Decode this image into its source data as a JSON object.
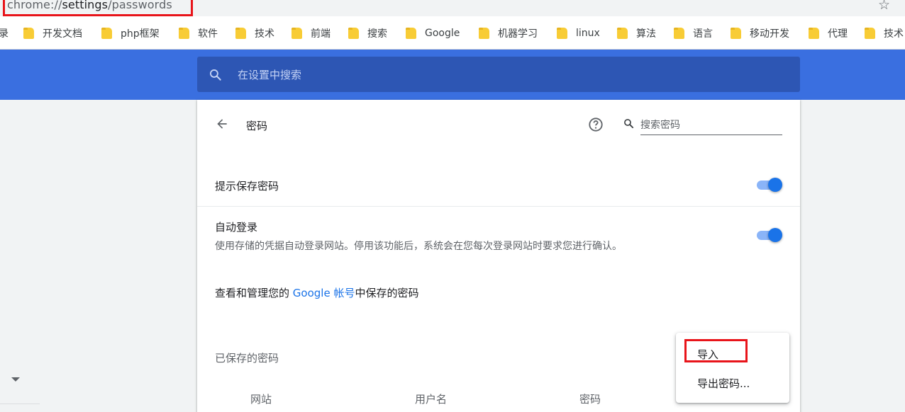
{
  "browser": {
    "url_prefix": "chrome://",
    "url_host": "settings",
    "url_sep": "/",
    "url_path": "passwords",
    "bookmark_icon": "star-icon"
  },
  "bookmarks": [
    "录",
    "开发文档",
    "php框架",
    "软件",
    "技术",
    "前端",
    "搜索",
    "Google",
    "机器学习",
    "linux",
    "算法",
    "语言",
    "移动开发",
    "代理",
    "技术"
  ],
  "settings": {
    "search_placeholder": "在设置中搜索"
  },
  "passwords": {
    "title": "密码",
    "search_placeholder": "搜索密码",
    "offer_to_save": "提示保存密码",
    "offer_to_save_enabled": true,
    "auto_signin": "自动登录",
    "auto_signin_desc": "使用存储的凭据自动登录网站。停用该功能后，系统会在您每次登录网站时要求您进行确认。",
    "auto_signin_enabled": true,
    "manage_prefix": "查看和管理您的 ",
    "manage_link": "Google 帐号",
    "manage_suffix": "中保存的密码",
    "saved_title": "已保存的密码",
    "columns": [
      "网站",
      "用户名",
      "密码"
    ]
  },
  "menu": {
    "import": "导入",
    "export": "导出密码..."
  },
  "colors": {
    "accent": "#1a73e8",
    "header": "#3a6fe0",
    "highlight": "#e8141a"
  }
}
